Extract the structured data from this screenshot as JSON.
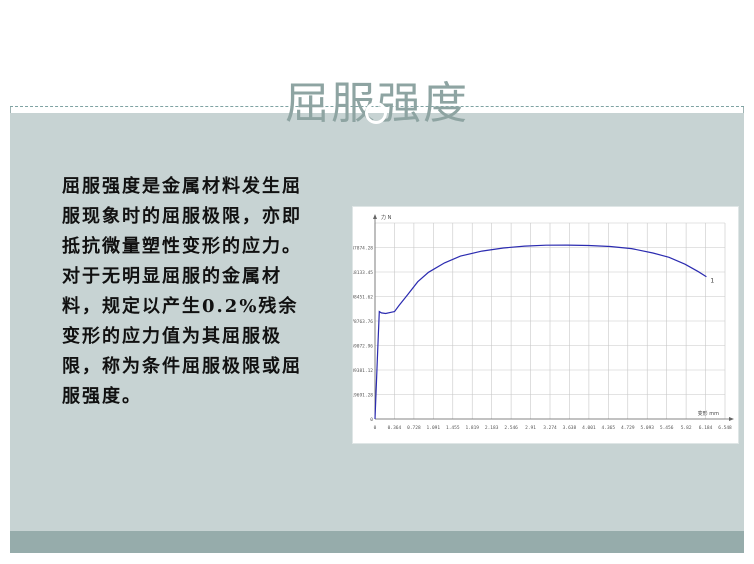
{
  "slide": {
    "title": "屈服强度",
    "paragraph": "屈服强度是金属材料发生屈服现象时的屈服极限，亦即抵抗微量塑性变形的应力。对于无明显屈服的金属材料，规定以产生0.2%残余变形的应力值为其屈服极限，称为条件屈服极限或屈服强度。"
  },
  "colors": {
    "title": "#8ea4a2",
    "body_band": "#c7d3d3",
    "bottom_bar": "#96acab",
    "curve": "#2b2bb0",
    "grid": "#c8c8c8"
  },
  "chart_data": {
    "type": "line",
    "ylabel": "力 N",
    "xlabel": "变形 mm",
    "x_ticks": [
      "0",
      "0.364",
      "0.728",
      "1.091",
      "1.455",
      "1.819",
      "2.183",
      "2.546",
      "2.91",
      "3.274",
      "3.638",
      "4.001",
      "4.365",
      "4.729",
      "5.093",
      "5.456",
      "5.82",
      "6.184",
      "6.548"
    ],
    "y_ticks": [
      "0",
      "19691.28",
      "39381.12",
      "59072.96",
      "78763.76",
      "98451.62",
      "118133.45",
      "137874.28"
    ],
    "xlim": [
      0,
      6.548
    ],
    "ylim": [
      0,
      157000
    ],
    "end_marker": "1",
    "series": [
      {
        "x": [
          0,
          0.05,
          0.08,
          0.12,
          0.2,
          0.3,
          0.364,
          0.45,
          0.6,
          0.8,
          1.0,
          1.3,
          1.6,
          2.0,
          2.4,
          2.8,
          3.2,
          3.6,
          4.0,
          4.4,
          4.8,
          5.2,
          5.5,
          5.8,
          6.05,
          6.2
        ],
        "y": [
          0,
          55000,
          86000,
          85000,
          84500,
          85500,
          86000,
          91000,
          99000,
          110000,
          117500,
          125000,
          130500,
          134500,
          137000,
          138500,
          139200,
          139300,
          139000,
          138200,
          136500,
          133000,
          129500,
          124000,
          118000,
          114000
        ]
      }
    ]
  }
}
